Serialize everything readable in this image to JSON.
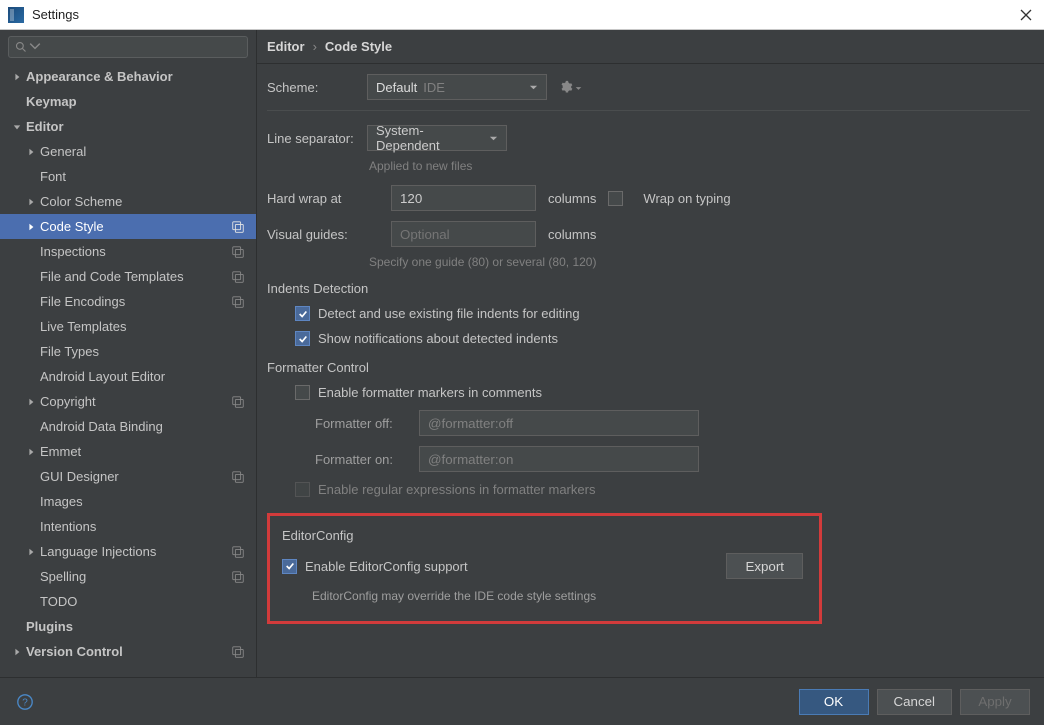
{
  "window": {
    "title": "Settings"
  },
  "sidebar": {
    "items": [
      {
        "label": "Appearance & Behavior",
        "level": 0,
        "expand": "closed",
        "bold": true
      },
      {
        "label": "Keymap",
        "level": 0,
        "expand": "none",
        "bold": true
      },
      {
        "label": "Editor",
        "level": 0,
        "expand": "open",
        "bold": true
      },
      {
        "label": "General",
        "level": 1,
        "expand": "closed"
      },
      {
        "label": "Font",
        "level": 1,
        "expand": "none"
      },
      {
        "label": "Color Scheme",
        "level": 1,
        "expand": "closed"
      },
      {
        "label": "Code Style",
        "level": 1,
        "expand": "closed",
        "selected": true,
        "scope": true
      },
      {
        "label": "Inspections",
        "level": 1,
        "expand": "none",
        "scope": true
      },
      {
        "label": "File and Code Templates",
        "level": 1,
        "expand": "none",
        "scope": true
      },
      {
        "label": "File Encodings",
        "level": 1,
        "expand": "none",
        "scope": true
      },
      {
        "label": "Live Templates",
        "level": 1,
        "expand": "none"
      },
      {
        "label": "File Types",
        "level": 1,
        "expand": "none"
      },
      {
        "label": "Android Layout Editor",
        "level": 1,
        "expand": "none"
      },
      {
        "label": "Copyright",
        "level": 1,
        "expand": "closed",
        "scope": true
      },
      {
        "label": "Android Data Binding",
        "level": 1,
        "expand": "none"
      },
      {
        "label": "Emmet",
        "level": 1,
        "expand": "closed"
      },
      {
        "label": "GUI Designer",
        "level": 1,
        "expand": "none",
        "scope": true
      },
      {
        "label": "Images",
        "level": 1,
        "expand": "none"
      },
      {
        "label": "Intentions",
        "level": 1,
        "expand": "none"
      },
      {
        "label": "Language Injections",
        "level": 1,
        "expand": "closed",
        "scope": true
      },
      {
        "label": "Spelling",
        "level": 1,
        "expand": "none",
        "scope": true
      },
      {
        "label": "TODO",
        "level": 1,
        "expand": "none"
      },
      {
        "label": "Plugins",
        "level": 0,
        "expand": "none",
        "bold": true
      },
      {
        "label": "Version Control",
        "level": 0,
        "expand": "closed",
        "bold": true,
        "scope": true
      }
    ]
  },
  "breadcrumb": {
    "parent": "Editor",
    "child": "Code Style"
  },
  "scheme": {
    "label": "Scheme:",
    "value": "Default",
    "tag": "IDE"
  },
  "line_separator": {
    "label": "Line separator:",
    "value": "System-Dependent",
    "hint": "Applied to new files"
  },
  "hard_wrap": {
    "label": "Hard wrap at",
    "value": "120",
    "unit": "columns",
    "wrap_on_typing": "Wrap on typing"
  },
  "visual_guides": {
    "label": "Visual guides:",
    "placeholder": "Optional",
    "unit": "columns",
    "hint": "Specify one guide (80) or several (80, 120)"
  },
  "indents": {
    "title": "Indents Detection",
    "detect": "Detect and use existing file indents for editing",
    "notify": "Show notifications about detected indents"
  },
  "formatter": {
    "title": "Formatter Control",
    "enable_markers": "Enable formatter markers in comments",
    "off_label": "Formatter off:",
    "off_value": "@formatter:off",
    "on_label": "Formatter on:",
    "on_value": "@formatter:on",
    "regex": "Enable regular expressions in formatter markers"
  },
  "editorconfig": {
    "title": "EditorConfig",
    "enable": "Enable EditorConfig support",
    "export": "Export",
    "hint": "EditorConfig may override the IDE code style settings"
  },
  "footer": {
    "ok": "OK",
    "cancel": "Cancel",
    "apply": "Apply"
  }
}
